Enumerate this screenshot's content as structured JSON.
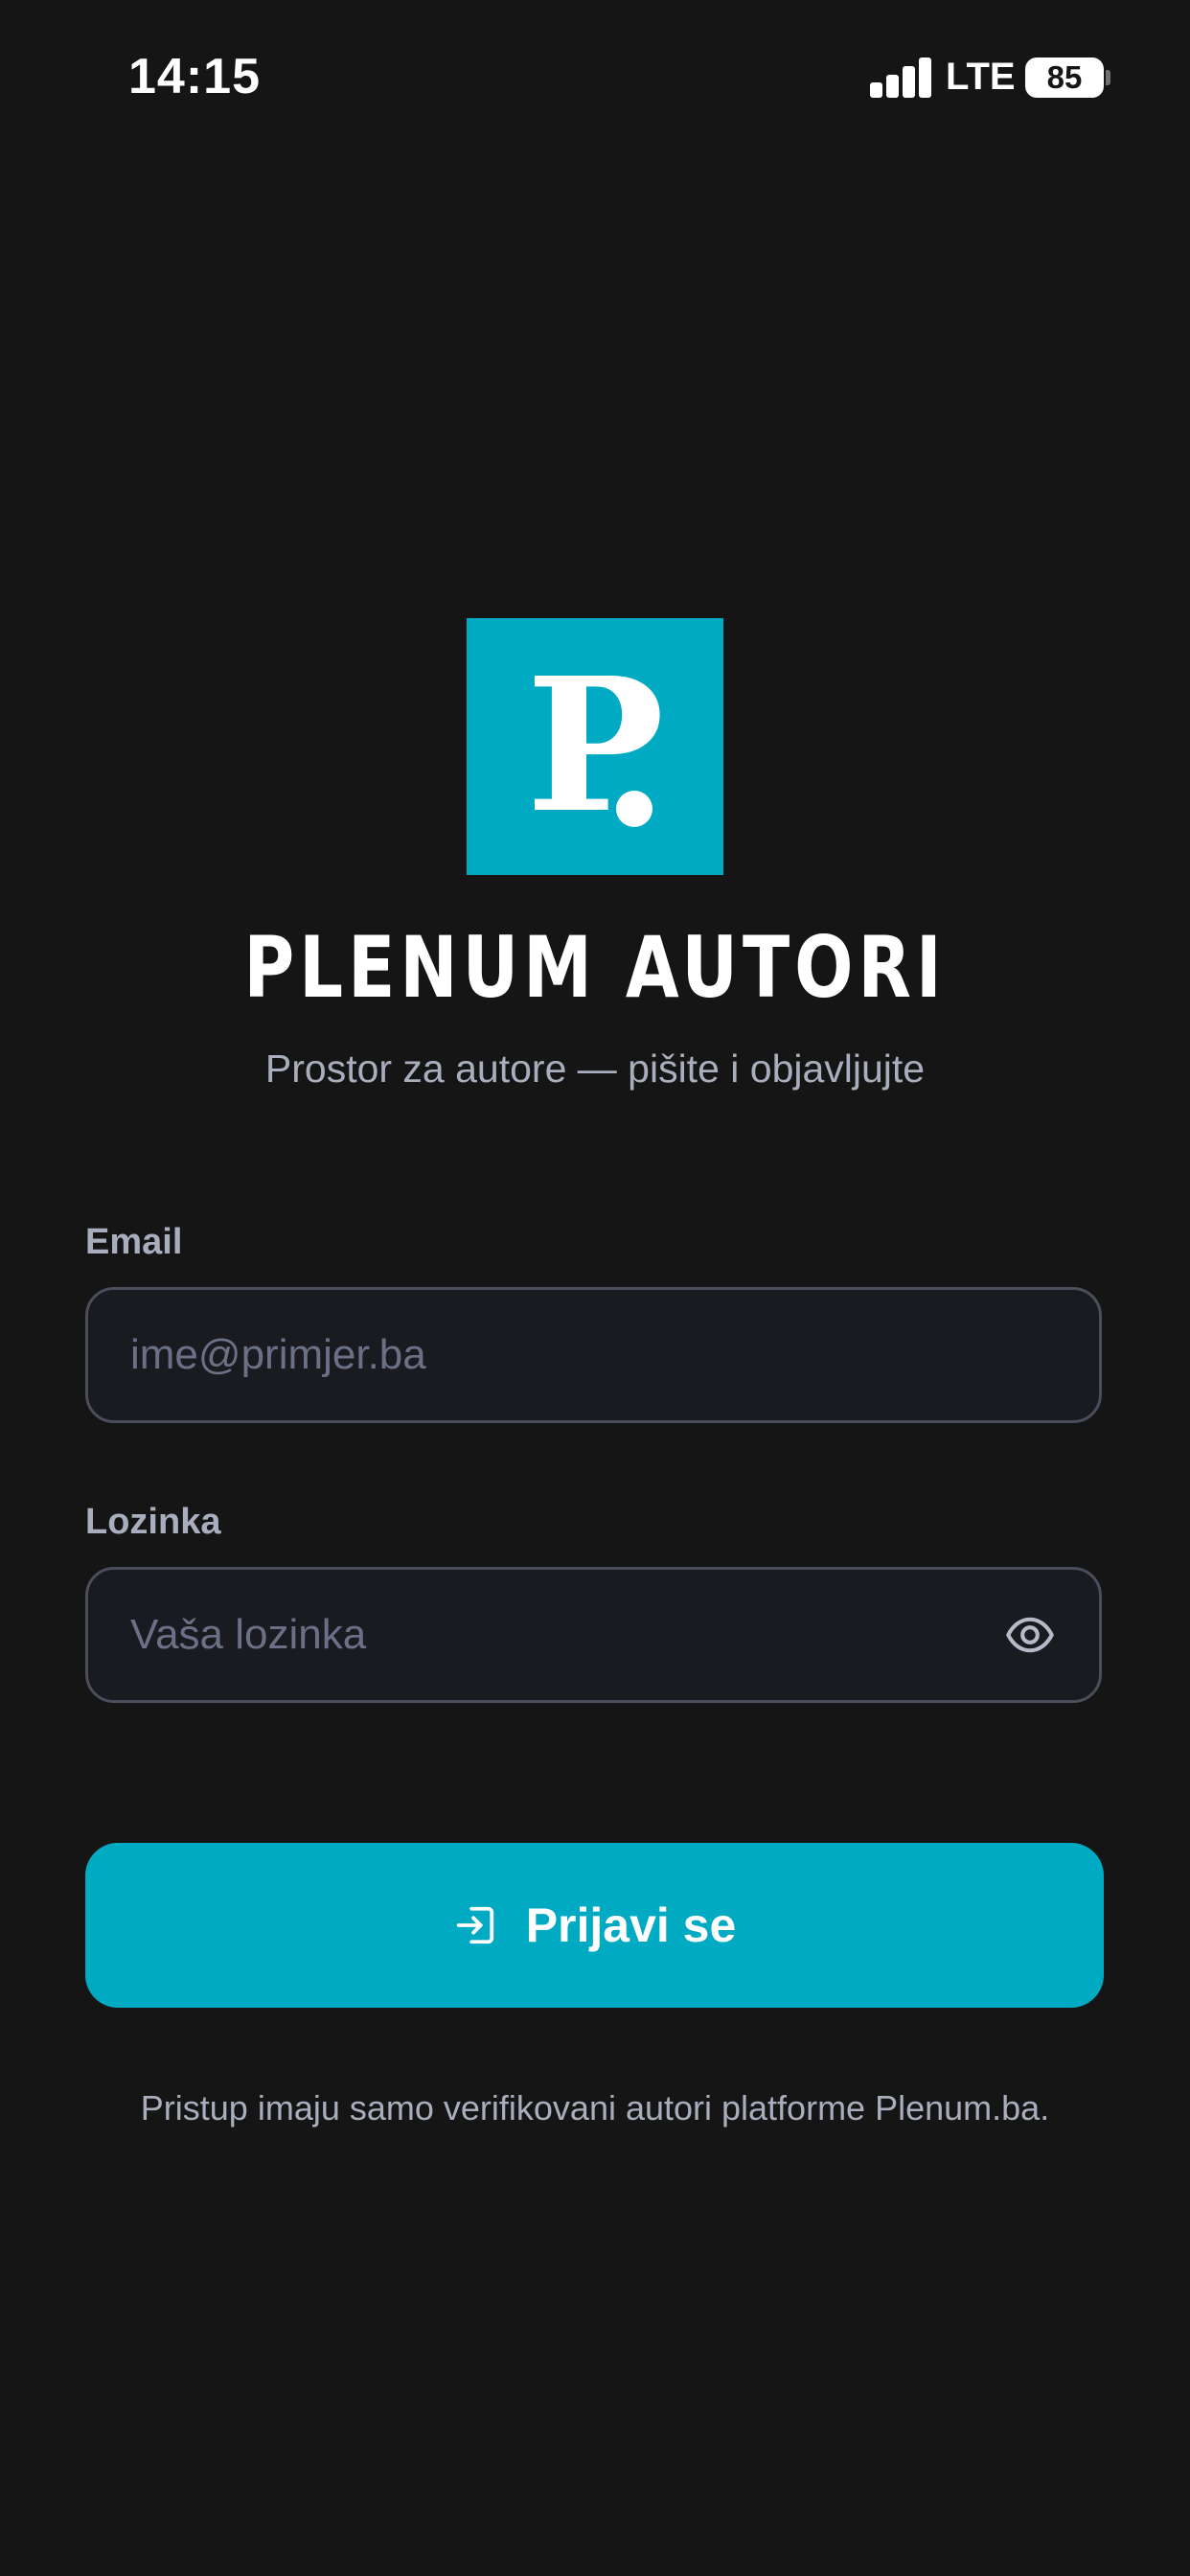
{
  "status_bar": {
    "time": "14:15",
    "network": "LTE",
    "battery": "85"
  },
  "logo": {
    "letter": "P"
  },
  "header": {
    "title": "PLENUM AUTORI",
    "subtitle": "Prostor za autore — pišite i objavljujte"
  },
  "form": {
    "email": {
      "label": "Email",
      "placeholder": "ime@primjer.ba",
      "value": ""
    },
    "password": {
      "label": "Lozinka",
      "placeholder": "Vaša lozinka",
      "value": ""
    },
    "submit_label": "Prijavi se"
  },
  "footer": {
    "note": "Pristup imaju samo verifikovani autori platforme Plenum.ba."
  },
  "colors": {
    "background": "#161516",
    "accent": "#01aac3",
    "input_background": "#1a1b20",
    "input_border": "#4a4d5a",
    "muted_text": "#a9aebc",
    "placeholder": "#6b7086"
  },
  "icons": {
    "signal": "signal-bars-icon",
    "battery": "battery-icon",
    "password_toggle": "eye-icon",
    "login": "login-arrow-icon"
  }
}
